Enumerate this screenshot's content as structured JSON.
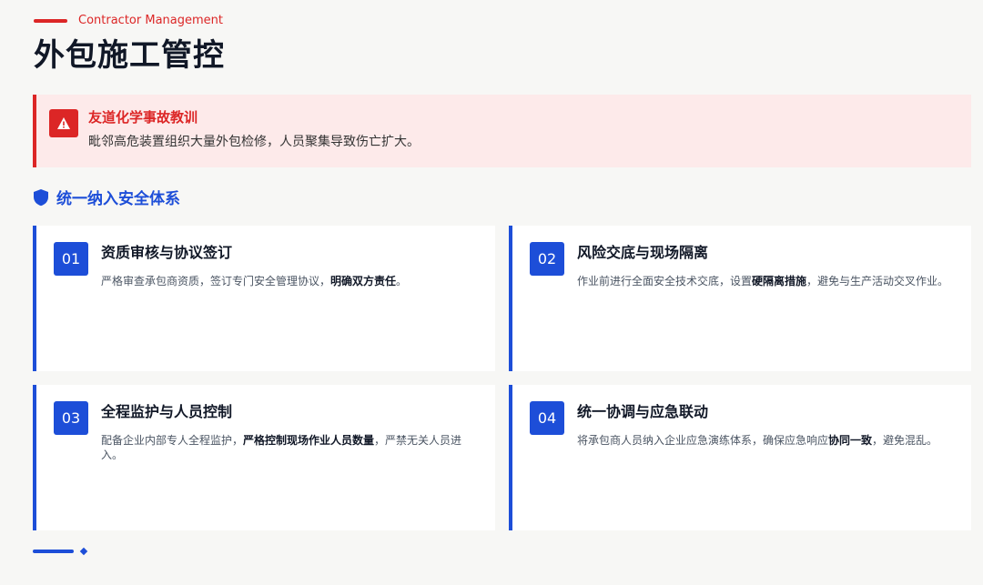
{
  "header": {
    "eyebrow": "Contractor Management",
    "title": "外包施工管控"
  },
  "alert": {
    "title": "友道化学事故教训",
    "body": "毗邻高危装置组织大量外包检修，人员聚集导致伤亡扩大。",
    "icon": "warning-icon",
    "color": "#dc2626",
    "background": "#fdeaea"
  },
  "section": {
    "title": "统一纳入安全体系",
    "icon": "shield-icon",
    "color": "#1d4ed8"
  },
  "cards": [
    {
      "number": "01",
      "title": "资质审核与协议签订",
      "body_pre": "严格审查承包商资质，签订专门安全管理协议，",
      "body_bold": "明确双方责任",
      "body_post": "。"
    },
    {
      "number": "02",
      "title": "风险交底与现场隔离",
      "body_pre": "作业前进行全面安全技术交底，设置",
      "body_bold": "硬隔离措施",
      "body_post": "，避免与生产活动交叉作业。"
    },
    {
      "number": "03",
      "title": "全程监护与人员控制",
      "body_pre": "配备企业内部专人全程监护，",
      "body_bold": "严格控制现场作业人员数量",
      "body_post": "，严禁无关人员进入。"
    },
    {
      "number": "04",
      "title": "统一协调与应急联动",
      "body_pre": "将承包商人员纳入企业应急演练体系，确保应急响应",
      "body_bold": "协同一致",
      "body_post": "，避免混乱。"
    }
  ]
}
